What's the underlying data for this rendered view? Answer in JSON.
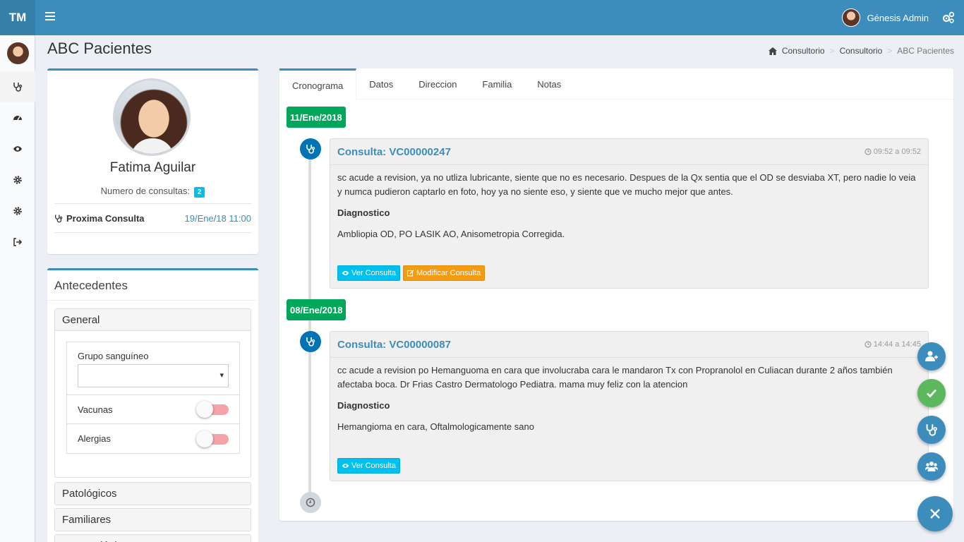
{
  "app": {
    "logo": "TM"
  },
  "header": {
    "user_name": "Génesis Admin"
  },
  "colors": {
    "primary": "#3c8dbc",
    "success": "#00a65a",
    "info": "#00c0ef",
    "warning": "#f39c12"
  },
  "sidebar": {
    "items": [
      {
        "icon": "stethoscope-icon"
      },
      {
        "icon": "dashboard-icon"
      },
      {
        "icon": "eye-icon"
      },
      {
        "icon": "gear-icon"
      },
      {
        "icon": "gear-icon"
      },
      {
        "icon": "sign-out-icon"
      }
    ]
  },
  "page": {
    "title": "ABC Pacientes",
    "breadcrumb": [
      "Consultorio",
      "Consultorio",
      "ABC Pacientes"
    ]
  },
  "profile": {
    "name": "Fatima Aguilar",
    "consult_label": "Numero de consultas:",
    "consult_count": "2",
    "next_label": "Proxima Consulta",
    "next_value": "19/Ene/18 11:00"
  },
  "antecedentes": {
    "title": "Antecedentes",
    "general": {
      "title": "General",
      "blood_label": "Grupo sanguíneo",
      "blood_value": "",
      "vacunas_label": "Vacunas",
      "alergias_label": "Alergias"
    },
    "sections": [
      "Patológicos",
      "Familiares",
      "No Patológicos"
    ]
  },
  "tabs": [
    "Cronograma",
    "Datos",
    "Direccion",
    "Familia",
    "Notas"
  ],
  "timeline": [
    {
      "date": "11/Ene/2018",
      "title": "Consulta: VC00000247",
      "time": "09:52 a 09:52",
      "body": "sc acude a revision, ya no utliza lubricante, siente que no es necesario. Despues de la Qx sentia que el OD se desviaba XT, pero nadie lo veia y numca pudieron captarlo en foto, hoy ya no siente eso, y siente que ve mucho mejor que antes.",
      "diag_label": "Diagnostico",
      "diag": "Ambliopia OD, PO LASIK AO, Anisometropia Corregida.",
      "btn_view": "Ver Consulta",
      "btn_edit": "Modificar Consulta"
    },
    {
      "date": "08/Ene/2018",
      "title": "Consulta: VC00000087",
      "time": "14:44 a 14:45",
      "body": "cc acude a revision po Hemanguoma en cara que involucraba cara le mandaron Tx con Propranolol en Culiacan durante 2 años también afectaba boca. Dr Frias Castro Dermatologo Pediatra. mama muy feliz con la atencion",
      "diag_label": "Diagnostico",
      "diag": "Hemangioma en cara, Oftalmologicamente sano",
      "btn_view": "Ver Consulta"
    }
  ],
  "fabs": [
    {
      "icon": "add-user-icon",
      "color": "#3c8dbc"
    },
    {
      "icon": "check-icon",
      "color": "#5cb85c"
    },
    {
      "icon": "stethoscope-icon",
      "color": "#3c8dbc"
    },
    {
      "icon": "users-icon",
      "color": "#3c8dbc"
    },
    {
      "icon": "close-icon",
      "color": "#3c8dbc"
    }
  ]
}
